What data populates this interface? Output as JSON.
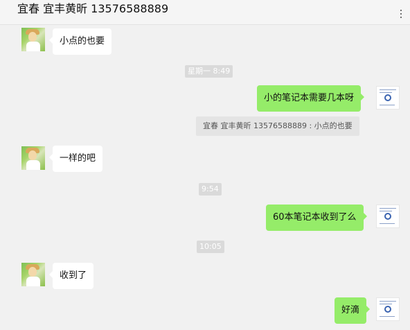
{
  "header": {
    "title": "宜春 宜丰黄昕 13576588889"
  },
  "messages": [
    {
      "text": "小点的也要"
    },
    {
      "text": "小的笔记本需要几本呀"
    },
    {
      "text": "一样的吧"
    },
    {
      "text": "60本笔记本收到了么"
    },
    {
      "text": "收到了"
    },
    {
      "text": "好滴"
    }
  ],
  "timestamps": [
    "星期一 8:49",
    "9:54",
    "10:05"
  ],
  "quote": {
    "text": "宜春 宜丰黄昕 13576588889 : 小点的也要"
  },
  "colors": {
    "outgoing_bubble": "#95ec69",
    "incoming_bubble": "#ffffff",
    "background": "#f1f1f1"
  },
  "icons": {
    "more": "more-vertical-icon"
  }
}
